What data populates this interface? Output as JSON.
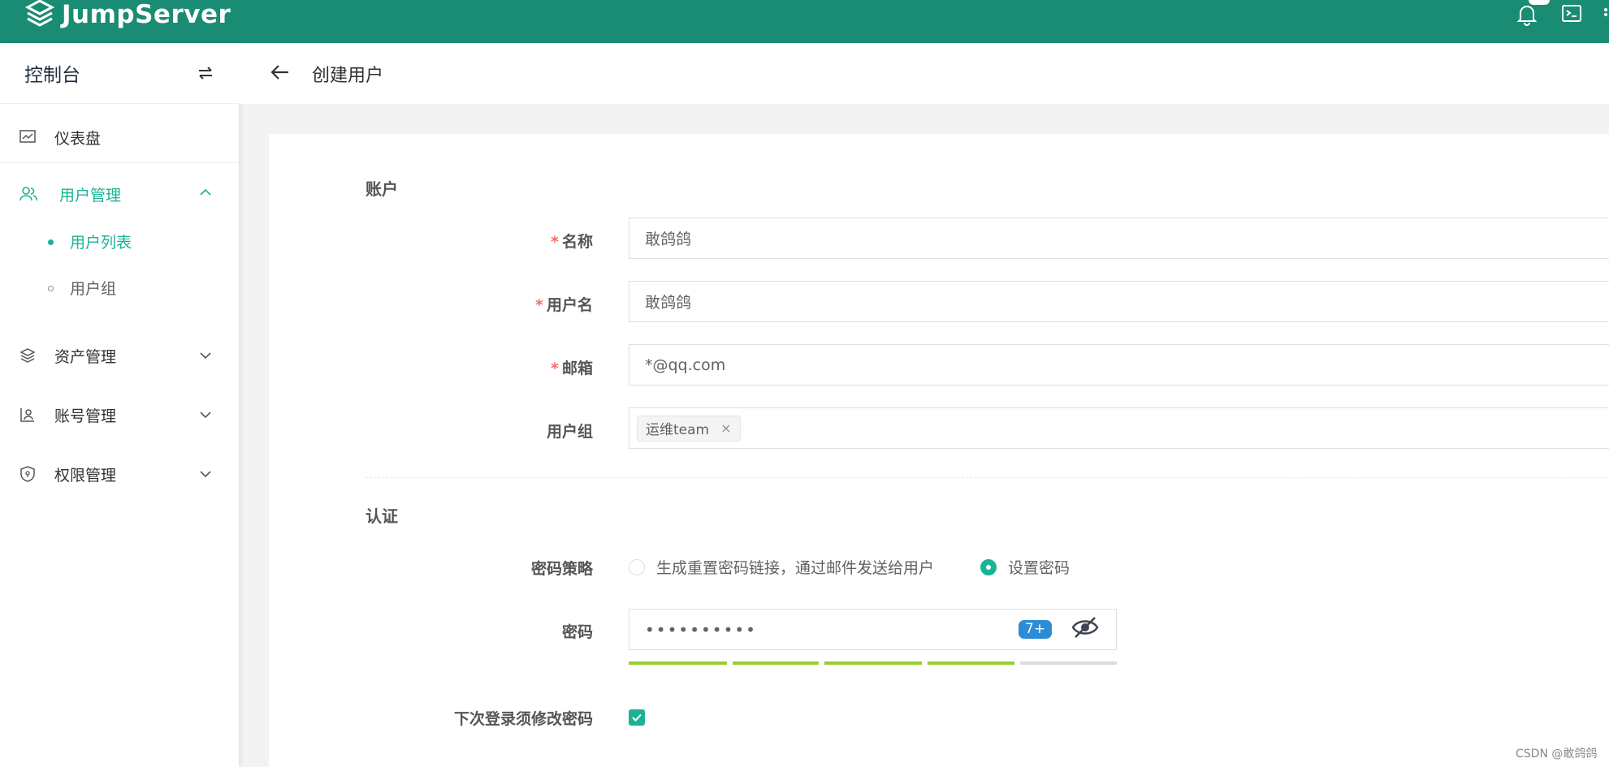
{
  "app": {
    "brand": "JumpServer"
  },
  "sidebar": {
    "title": "控制台",
    "items": [
      {
        "label": "仪表盘",
        "icon": "dashboard-icon"
      },
      {
        "label": "用户管理",
        "icon": "users-icon",
        "active": true,
        "expanded": true,
        "children": [
          {
            "label": "用户列表",
            "active": true
          },
          {
            "label": "用户组"
          }
        ]
      },
      {
        "label": "资产管理",
        "icon": "stack-icon"
      },
      {
        "label": "账号管理",
        "icon": "account-icon"
      },
      {
        "label": "权限管理",
        "icon": "shield-icon"
      }
    ]
  },
  "page": {
    "title": "创建用户"
  },
  "form": {
    "section_account": "账户",
    "name_label": "名称",
    "name_value": "敢鸽鸽",
    "username_label": "用户名",
    "username_value": "敢鸽鸽",
    "email_label": "邮箱",
    "email_value": "*@qq.com",
    "group_label": "用户组",
    "group_tag": "运维team",
    "group_tag_close": "×",
    "section_auth": "认证",
    "password_strategy_label": "密码策略",
    "strategy_option_1": "生成重置密码链接，通过邮件发送给用户",
    "strategy_option_2": "设置密码",
    "strategy_selected": 2,
    "password_label": "密码",
    "password_value": "••••••••••",
    "password_badge": "7+",
    "password_strength": 0.8,
    "must_change_label": "下次登录须修改密码",
    "must_change_checked": true
  },
  "colors": {
    "topbar": "#1a8c73",
    "accent": "#1ab394",
    "strength": "#9acd32",
    "required": "#f56c6c",
    "badge": "#2c8cd6"
  },
  "watermark": "CSDN @敢鸽鸽"
}
